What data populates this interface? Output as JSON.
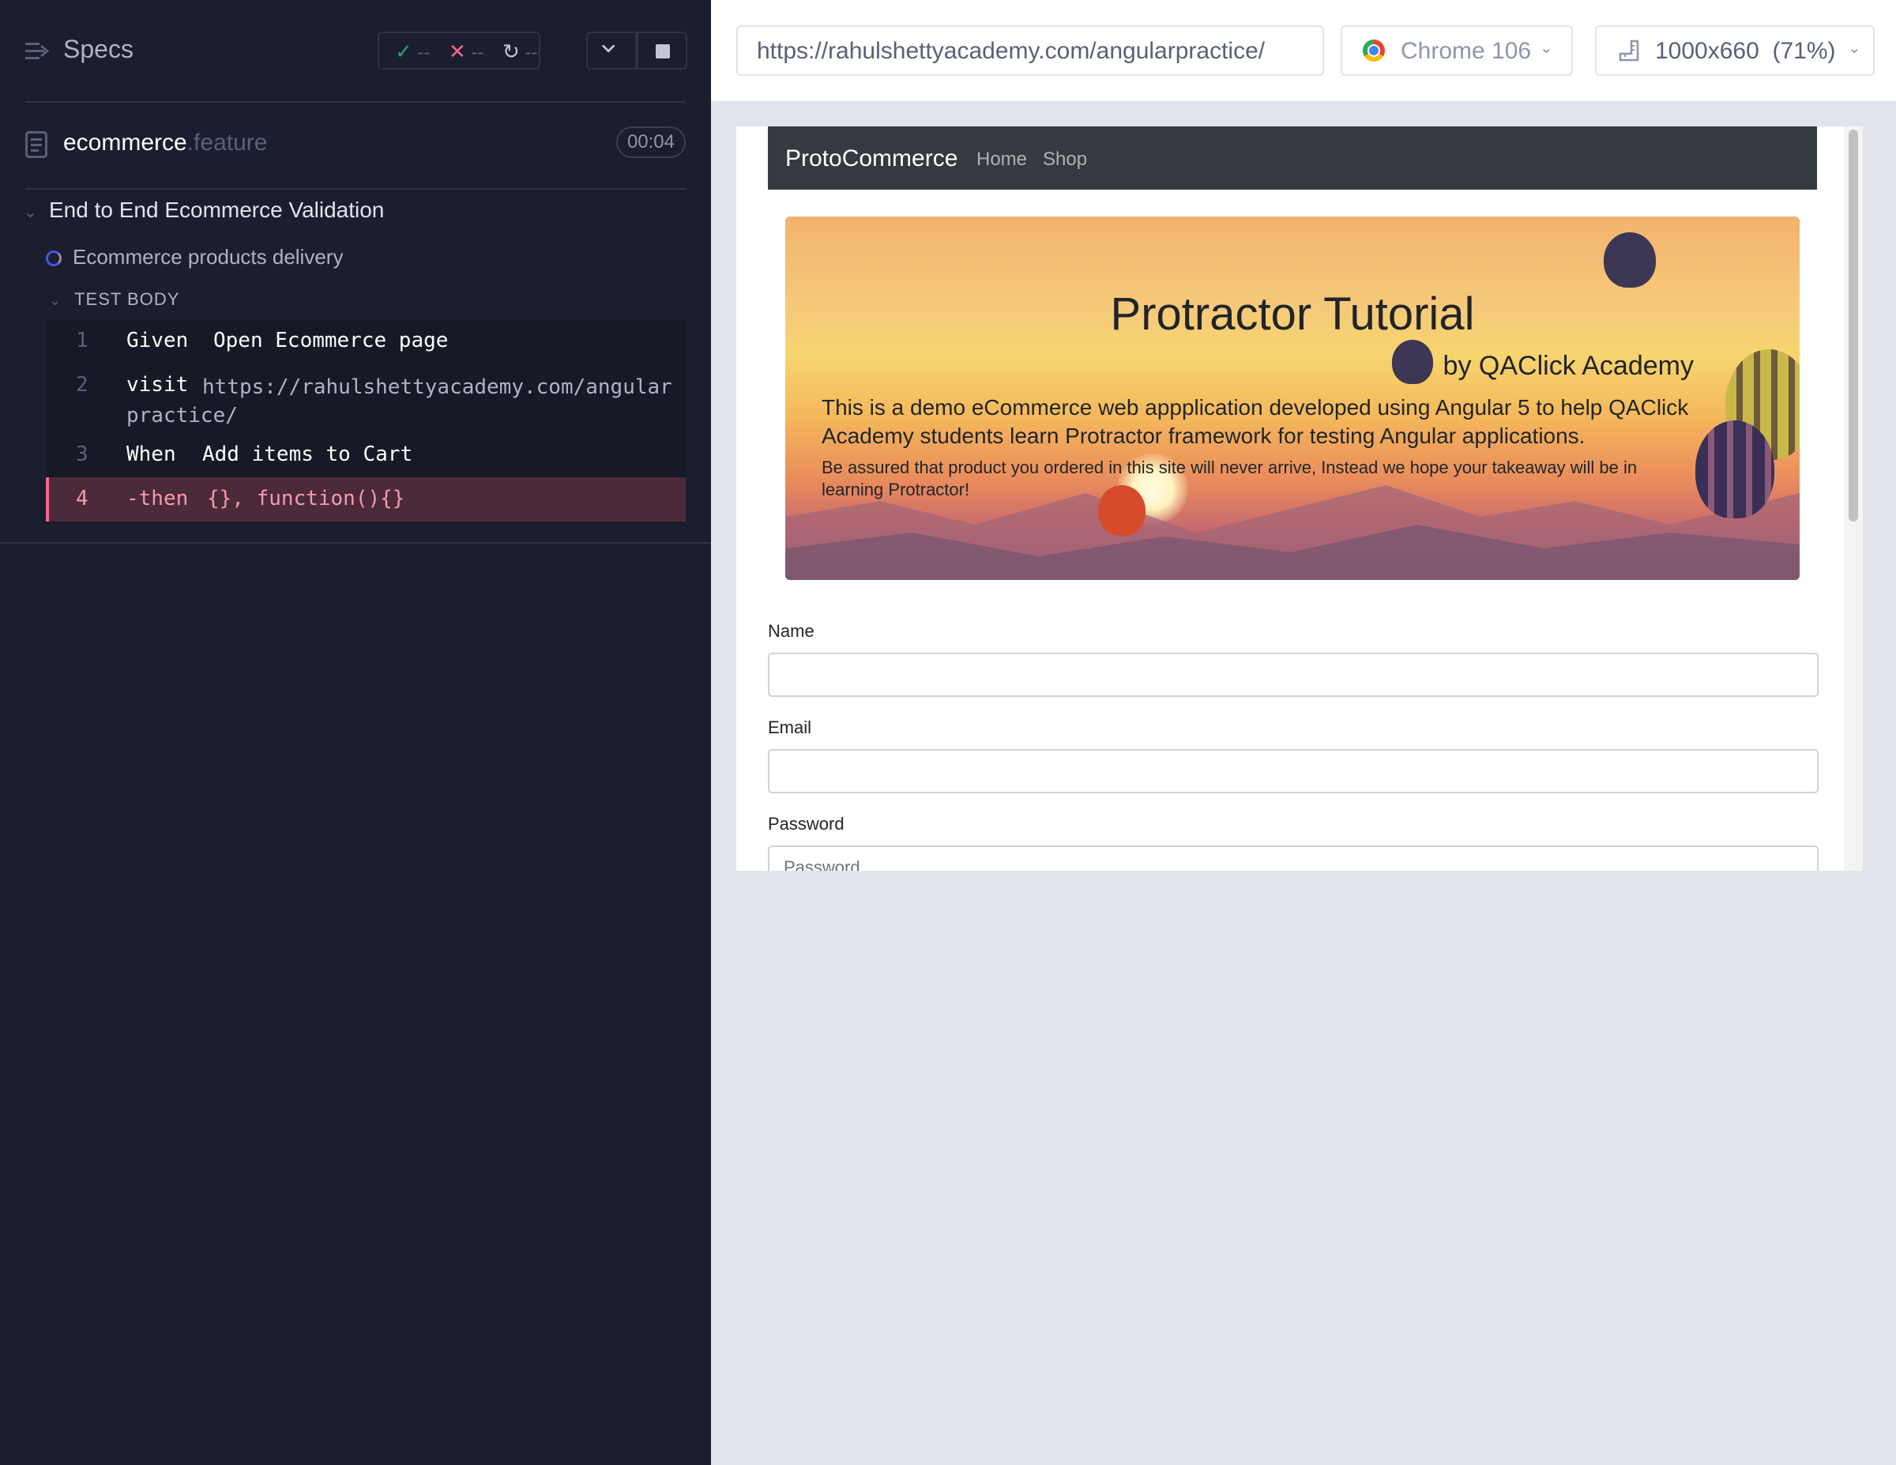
{
  "reporter": {
    "header": {
      "title": "Specs",
      "passed": "--",
      "failed": "--",
      "pending": "--"
    },
    "file": {
      "name": "ecommerce",
      "ext": ".feature",
      "duration": "00:04"
    },
    "suite": {
      "title": "End to End Ecommerce Validation"
    },
    "test": {
      "title": "Ecommerce products delivery",
      "body_label": "TEST BODY"
    },
    "commands": [
      {
        "num": "1",
        "name": "Given",
        "message": "Open Ecommerce page"
      },
      {
        "num": "2",
        "name": "visit",
        "message": "https://rahulshettyacademy.com/angularpractice/"
      },
      {
        "num": "3",
        "name": "When",
        "message": "Add items to Cart"
      },
      {
        "num": "4",
        "name": "-then",
        "message": "{}, function(){}"
      }
    ]
  },
  "aut": {
    "url": "https://rahulshettyacademy.com/angularpractice/",
    "browser": "Chrome 106",
    "viewport": "1000x660",
    "zoom": "(71%)",
    "page": {
      "brand": "ProtoCommerce",
      "nav": [
        "Home",
        "Shop"
      ],
      "jumbotron": {
        "title": "Protractor Tutorial",
        "subtitle": "by QAClick Academy",
        "lead": "This is a demo eCommerce web appplication developed using Angular 5 to help QAClick Academy students learn Protractor framework for testing Angular applications.",
        "note": "Be assured that product you ordered in this site will never arrive, Instead we hope your takeaway will be in learning Protractor!"
      },
      "form": {
        "name_label": "Name",
        "email_label": "Email",
        "password_label": "Password",
        "password_placeholder": "Password"
      }
    }
  }
}
